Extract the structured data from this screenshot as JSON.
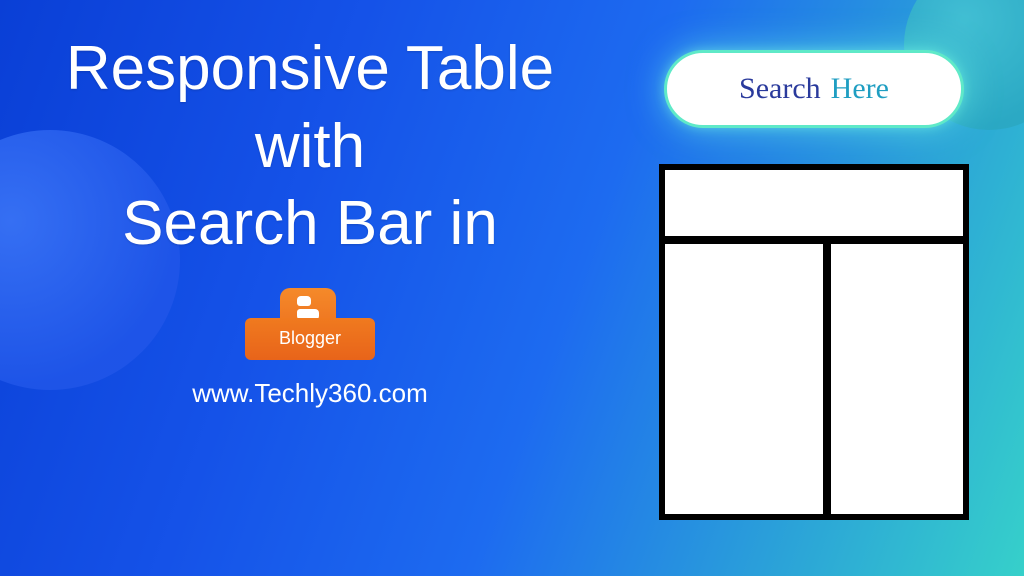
{
  "title": {
    "line1": "Responsive Table",
    "line2": "with",
    "line3": "Search Bar in"
  },
  "blogger": {
    "label": "Blogger"
  },
  "website": "www.Techly360.com",
  "search": {
    "word1": "Search",
    "word2": "Here"
  }
}
